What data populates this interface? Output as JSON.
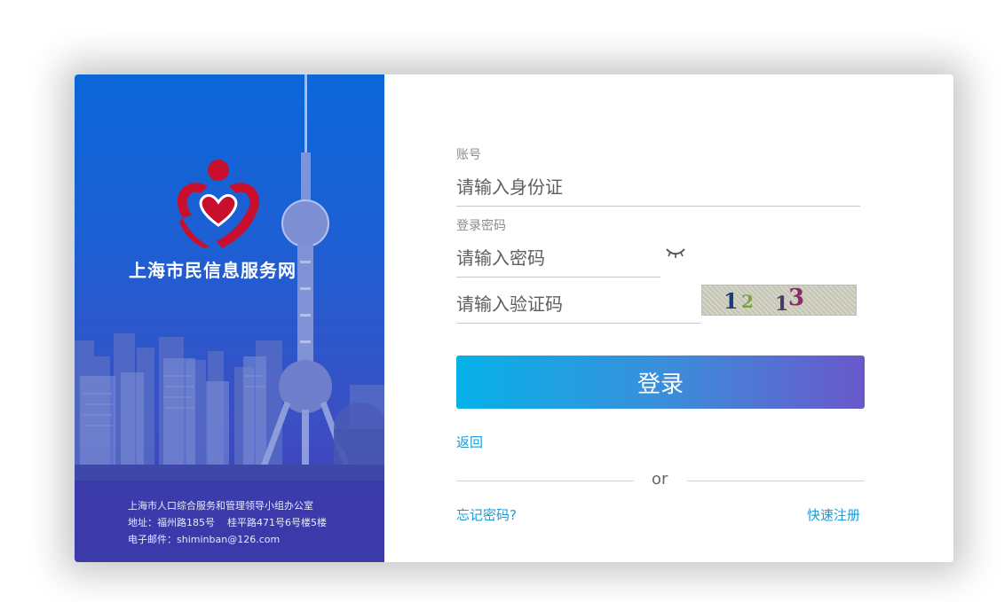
{
  "brand": {
    "site_name": "上海市民信息服务网",
    "logo_color": "#c8102e"
  },
  "footer": {
    "org": "上海市人口综合服务和管理领导小组办公室",
    "address": "地址：福州路185号    桂平路471号6号楼5楼",
    "email": "电子邮件：shiminban@126.com"
  },
  "form": {
    "account_label": "账号",
    "account_placeholder": "请输入身份证",
    "password_label": "登录密码",
    "password_placeholder": "请输入密码",
    "captcha_placeholder": "请输入验证码",
    "captcha_text": [
      "1",
      "2",
      "1",
      "3"
    ],
    "login_label": "登录",
    "back_label": "返回",
    "or_label": "or",
    "forgot_label": "忘记密码?",
    "register_label": "快速注册"
  },
  "colors": {
    "link": "#1a9bd7",
    "button_start": "#06b1e8",
    "button_end": "#6a58cb",
    "panel_top": "#0b67d8",
    "panel_bottom": "#4637b0"
  }
}
